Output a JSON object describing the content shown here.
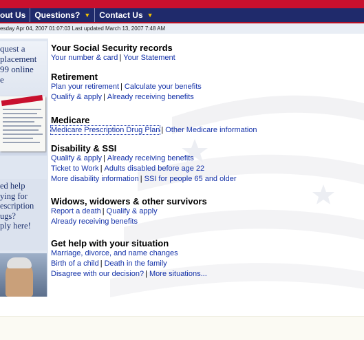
{
  "nav": {
    "items": [
      {
        "label": "out Us",
        "has_menu": false
      },
      {
        "label": "Questions?",
        "has_menu": true
      },
      {
        "label": "Contact Us",
        "has_menu": true
      }
    ]
  },
  "datebar": {
    "text": "esday Apr 04, 2007 01:07:03 Last updated March 13, 2007 7:48 AM"
  },
  "left_promos": {
    "promo1_text": [
      "quest a",
      "placement",
      "99 online",
      "e"
    ],
    "promo2_text": [
      "ed help",
      "ying for",
      "escription",
      "ugs?",
      "ply here!"
    ]
  },
  "sections": {
    "ss_records": {
      "title": "Your Social Security records",
      "rows": [
        [
          "Your number & card",
          "Your Statement"
        ]
      ]
    },
    "retirement": {
      "title": "Retirement",
      "rows": [
        [
          "Plan your retirement",
          "Calculate your benefits"
        ],
        [
          "Qualify & apply",
          "Already receiving benefits"
        ]
      ]
    },
    "medicare": {
      "title": "Medicare",
      "rows": [
        [
          "Medicare Prescription Drug Plan",
          "Other Medicare information"
        ]
      ]
    },
    "disability": {
      "title": "Disability & SSI",
      "rows": [
        [
          "Qualify & apply",
          "Already receiving benefits"
        ],
        [
          "Ticket to Work",
          "Adults disabled before age 22"
        ],
        [
          "More disability information",
          "SSI for people 65 and older"
        ]
      ]
    },
    "survivors": {
      "title": "Widows, widowers & other survivors",
      "rows": [
        [
          "Report a death",
          "Qualify & apply"
        ],
        [
          "Already receiving benefits"
        ]
      ]
    },
    "help": {
      "title": "Get help with your situation",
      "rows": [
        [
          "Marriage, divorce, and name changes"
        ],
        [
          "Birth of a child",
          "Death in the family"
        ],
        [
          "Disagree with our decision?",
          "More situations..."
        ]
      ]
    }
  },
  "separator": "|",
  "caret": "▼",
  "colors": {
    "nav_bg": "#1f2a6b",
    "top_red": "#c8102e",
    "link": "#1230a8",
    "caret": "#f3c200"
  }
}
